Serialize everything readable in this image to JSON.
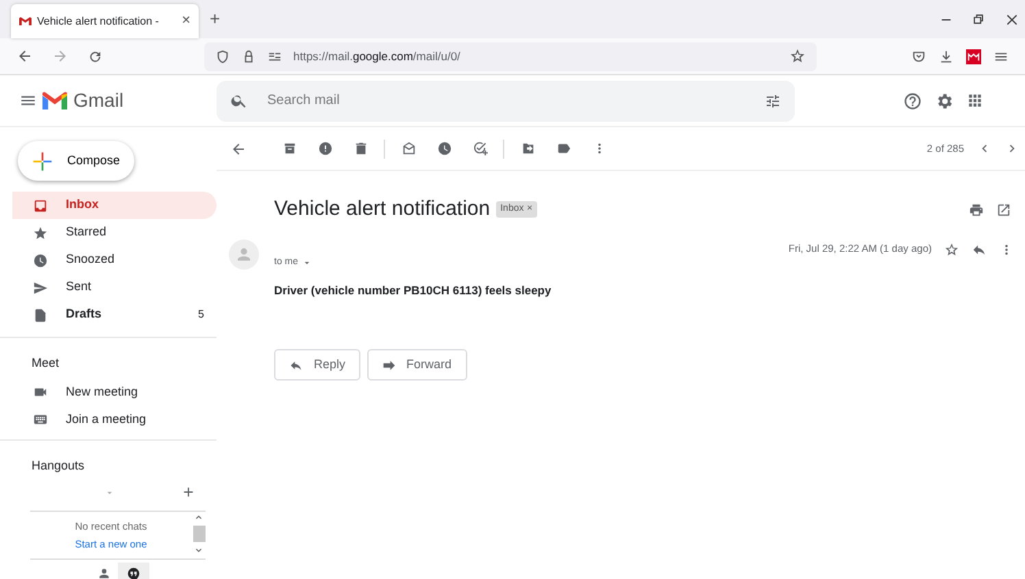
{
  "browser": {
    "tab": {
      "title": "Vehicle alert notification -",
      "close": "×"
    },
    "new_tab": "+",
    "url": "https://mail.**google.com**/mail/u/0/"
  },
  "header": {
    "app_name": "Gmail",
    "search": {
      "placeholder": "Search mail"
    }
  },
  "compose": "Compose",
  "folders": [
    {
      "label": "Inbox",
      "kind": "inbox",
      "selected": true,
      "bold": true
    },
    {
      "label": "Starred",
      "kind": "star",
      "selected": false,
      "bold": false
    },
    {
      "label": "Snoozed",
      "kind": "clock",
      "selected": false,
      "bold": false
    },
    {
      "label": "Sent",
      "kind": "send",
      "selected": false,
      "bold": false
    },
    {
      "label": "Drafts",
      "kind": "file",
      "selected": false,
      "bold": true,
      "count": "5"
    }
  ],
  "meet": {
    "title": "Meet",
    "items": [
      {
        "label": "New meeting",
        "kind": "video"
      },
      {
        "label": "Join a meeting",
        "kind": "keyboard"
      }
    ]
  },
  "hangouts": {
    "title": "Hangouts",
    "empty": "No recent chats",
    "link": "Start a new one"
  },
  "toolbar": {
    "counter": "2 of 285"
  },
  "message": {
    "subject": "Vehicle alert notification",
    "label": "Inbox",
    "label_close": "×",
    "recipient": "to me",
    "date": "Fri, Jul 29, 2:22 AM (1 day ago)",
    "body": "Driver (vehicle number PB10CH 6113) feels sleepy"
  },
  "actions": [
    {
      "label": "Reply",
      "kind": "reply"
    },
    {
      "label": "Forward",
      "kind": "forward"
    }
  ]
}
